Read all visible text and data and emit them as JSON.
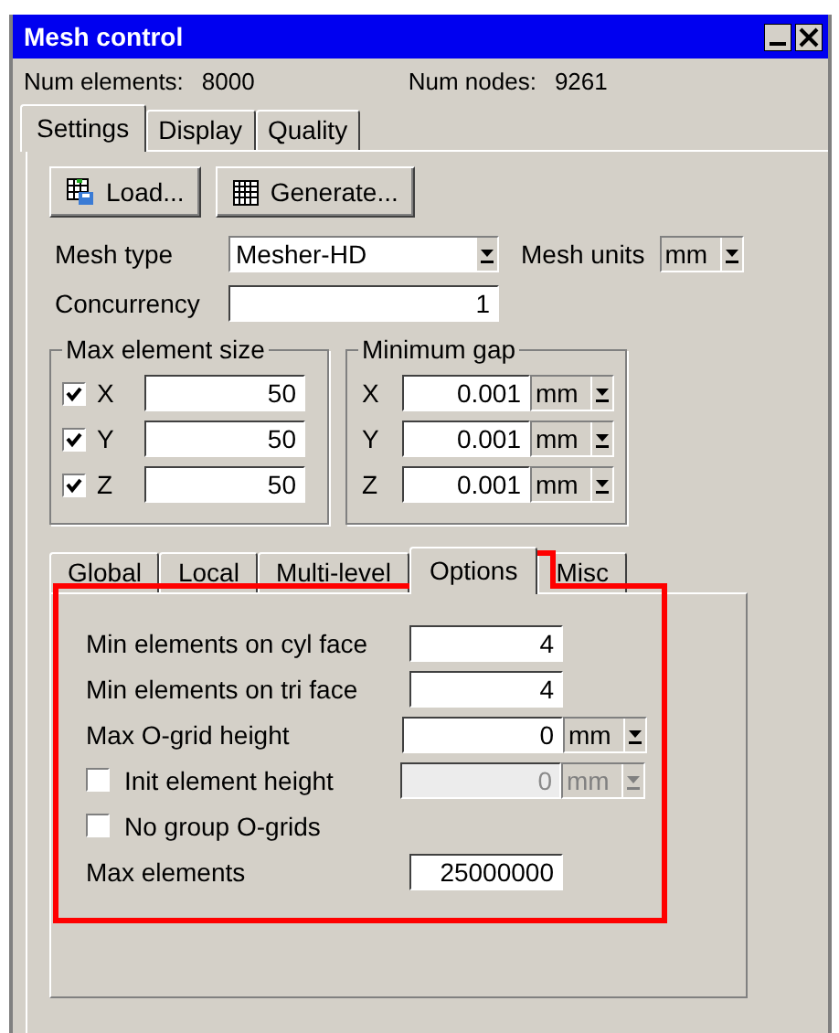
{
  "window": {
    "title": "Mesh control"
  },
  "stats": [
    {
      "label": "Num elements:",
      "value": "8000"
    },
    {
      "label": "Num nodes:",
      "value": "9261"
    }
  ],
  "tabs": [
    {
      "label": "Settings",
      "selected": true
    },
    {
      "label": "Display",
      "selected": false
    },
    {
      "label": "Quality",
      "selected": false
    }
  ],
  "toolbar": [
    {
      "label": "Load...",
      "kind": "load"
    },
    {
      "label": "Generate...",
      "kind": "generate"
    }
  ],
  "mesh_type": {
    "label": "Mesh type",
    "value": "Mesher-HD"
  },
  "mesh_units": {
    "label": "Mesh units",
    "value": "mm"
  },
  "concurrency": {
    "label": "Concurrency",
    "value": "1"
  },
  "max_element_size": {
    "title": "Max element size",
    "rows": [
      {
        "axis": "X",
        "checked": true,
        "value": "50"
      },
      {
        "axis": "Y",
        "checked": true,
        "value": "50"
      },
      {
        "axis": "Z",
        "checked": true,
        "value": "50"
      }
    ]
  },
  "minimum_gap": {
    "title": "Minimum gap",
    "rows": [
      {
        "axis": "X",
        "value": "0.001",
        "unit": "mm"
      },
      {
        "axis": "Y",
        "value": "0.001",
        "unit": "mm"
      },
      {
        "axis": "Z",
        "value": "0.001",
        "unit": "mm"
      }
    ]
  },
  "sub_tabs": [
    {
      "label": "Global",
      "selected": false
    },
    {
      "label": "Local",
      "selected": false
    },
    {
      "label": "Multi-level",
      "selected": false
    },
    {
      "label": "Options",
      "selected": true
    },
    {
      "label": "Misc",
      "selected": false
    }
  ],
  "options": [
    {
      "kind": "field",
      "label": "Min elements on cyl face",
      "value": "4"
    },
    {
      "kind": "field",
      "label": "Min elements on tri face",
      "value": "4"
    },
    {
      "kind": "field_unit",
      "label": "Max O-grid height",
      "value": "0",
      "unit": "mm"
    },
    {
      "kind": "check_field_unit",
      "label": "Init element height",
      "checked": false,
      "disabled": true,
      "value": "0",
      "unit": "mm"
    },
    {
      "kind": "check",
      "label": "No group O-grids",
      "checked": false
    },
    {
      "kind": "field",
      "label": "Max elements",
      "value": "25000000"
    }
  ],
  "highlight": {
    "on": true
  }
}
